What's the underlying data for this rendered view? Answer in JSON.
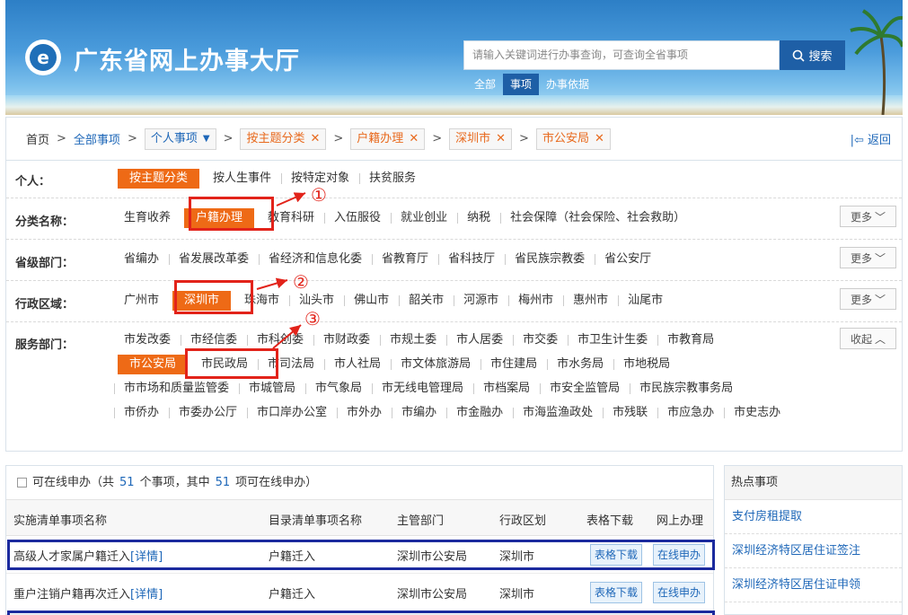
{
  "header": {
    "site_title": "广东省网上办事大厅",
    "logo_glyph": "e",
    "search_placeholder": "请输入关键词进行办事查询，可查询全省事项",
    "search_button": "搜索",
    "search_tabs": [
      "全部",
      "事项",
      "办事依据"
    ],
    "active_search_tab": "事项"
  },
  "breadcrumb": {
    "home": "首页",
    "all_items": "全部事项",
    "chips": [
      {
        "label": "个人事项",
        "type": "dropdown"
      },
      {
        "label": "按主题分类",
        "type": "removable"
      },
      {
        "label": "户籍办理",
        "type": "removable"
      },
      {
        "label": "深圳市",
        "type": "removable"
      },
      {
        "label": "市公安局",
        "type": "removable"
      }
    ],
    "back": "返回"
  },
  "filters": {
    "personal": {
      "label": "个人：",
      "items": [
        "按主题分类",
        "按人生事件",
        "按特定对象",
        "扶贫服务"
      ],
      "selected": "按主题分类"
    },
    "category": {
      "label": "分类名称：",
      "items": [
        "生育收养",
        "户籍办理",
        "教育科研",
        "入伍服役",
        "就业创业",
        "纳税",
        "社会保障（社会保险、社会救助）"
      ],
      "selected": "户籍办理",
      "more": "更多"
    },
    "province_dept": {
      "label": "省级部门：",
      "items": [
        "省编办",
        "省发展改革委",
        "省经济和信息化委",
        "省教育厅",
        "省科技厅",
        "省民族宗教委",
        "省公安厅"
      ],
      "more": "更多"
    },
    "region": {
      "label": "行政区域：",
      "items": [
        "广州市",
        "深圳市",
        "珠海市",
        "汕头市",
        "佛山市",
        "韶关市",
        "河源市",
        "梅州市",
        "惠州市",
        "汕尾市"
      ],
      "selected": "深圳市",
      "more": "更多"
    },
    "service_dept": {
      "label": "服务部门：",
      "items": [
        "市发改委",
        "市经信委",
        "市科创委",
        "市财政委",
        "市规土委",
        "市人居委",
        "市交委",
        "市卫生计生委",
        "市教育局",
        "市公安局",
        "市民政局",
        "市司法局",
        "市人社局",
        "市文体旅游局",
        "市住建局",
        "市水务局",
        "市地税局",
        "市市场和质量监管委",
        "市城管局",
        "市气象局",
        "市无线电管理局",
        "市档案局",
        "市安全监管局",
        "市民族宗教事务局",
        "市侨办",
        "市委办公厅",
        "市口岸办公室",
        "市外办",
        "市编办",
        "市金融办",
        "市海监渔政处",
        "市残联",
        "市应急办",
        "市史志办"
      ],
      "selected": "市公安局",
      "collapse": "收起"
    }
  },
  "annotations": [
    "①",
    "②",
    "③"
  ],
  "results": {
    "header_prefix": "可在线申办（共",
    "total": "51",
    "header_mid": "个事项，其中",
    "online": "51",
    "header_suffix": "项可在线申办）",
    "columns": [
      "实施清单事项名称",
      "目录清单事项名称",
      "主管部门",
      "行政区划",
      "表格下载",
      "网上办理"
    ],
    "rows": [
      {
        "name": "高级人才家属户籍迁入",
        "detail": "[详情]",
        "catalog": "户籍迁入",
        "dept": "深圳市公安局",
        "region": "深圳市",
        "download": "表格下载",
        "apply": "在线申办"
      },
      {
        "name": "重户注销户籍再次迁入",
        "detail": "[详情]",
        "catalog": "户籍迁入",
        "dept": "深圳市公安局",
        "region": "深圳市",
        "download": "表格下载",
        "apply": "在线申办"
      }
    ]
  },
  "hot": {
    "title": "热点事项",
    "items": [
      "支付房租提取",
      "深圳经济特区居住证签注",
      "深圳经济特区居住证申领"
    ]
  },
  "colors": {
    "accent_orange": "#ee6a16",
    "link_blue": "#1e67b8",
    "annotation_red": "#e2231a",
    "highlight_blue": "#1b2a9e",
    "header_blue": "#2d7fc6"
  }
}
